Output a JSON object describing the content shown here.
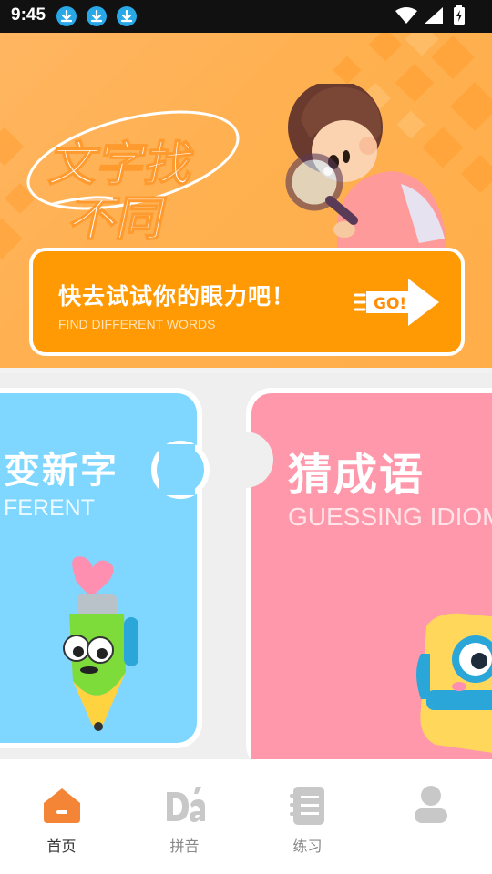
{
  "status_bar": {
    "time": "9:45",
    "icons": [
      "download-icon",
      "download-icon",
      "download-icon",
      "wifi-icon",
      "signal-icon",
      "battery-charging-icon"
    ]
  },
  "banner": {
    "logo_text": "文字找不同",
    "cta_title": "快去试试你的眼力吧！",
    "cta_subtitle": "FIND DIFFERENT WORDS",
    "go_label": "GO!"
  },
  "cards": [
    {
      "title": "变新字",
      "subtitle": "FERENT",
      "color": "#7fd6ff"
    },
    {
      "title": "猜成语",
      "subtitle": "GUESSING IDIOM",
      "color": "#ff98ab"
    }
  ],
  "tabs": [
    {
      "label": "首页",
      "icon": "home-icon",
      "active": true
    },
    {
      "label": "拼音",
      "icon": "pinyin-icon",
      "active": false
    },
    {
      "label": "练习",
      "icon": "notebook-icon",
      "active": false
    },
    {
      "label": "",
      "icon": "user-icon",
      "active": false
    }
  ],
  "colors": {
    "accent": "#ff9a05",
    "banner_bg": "#ffb04f",
    "card_blue": "#7fd6ff",
    "card_pink": "#ff98ab",
    "tab_active_icon": "#f58536",
    "tab_inactive_icon": "#c8c8c8"
  }
}
